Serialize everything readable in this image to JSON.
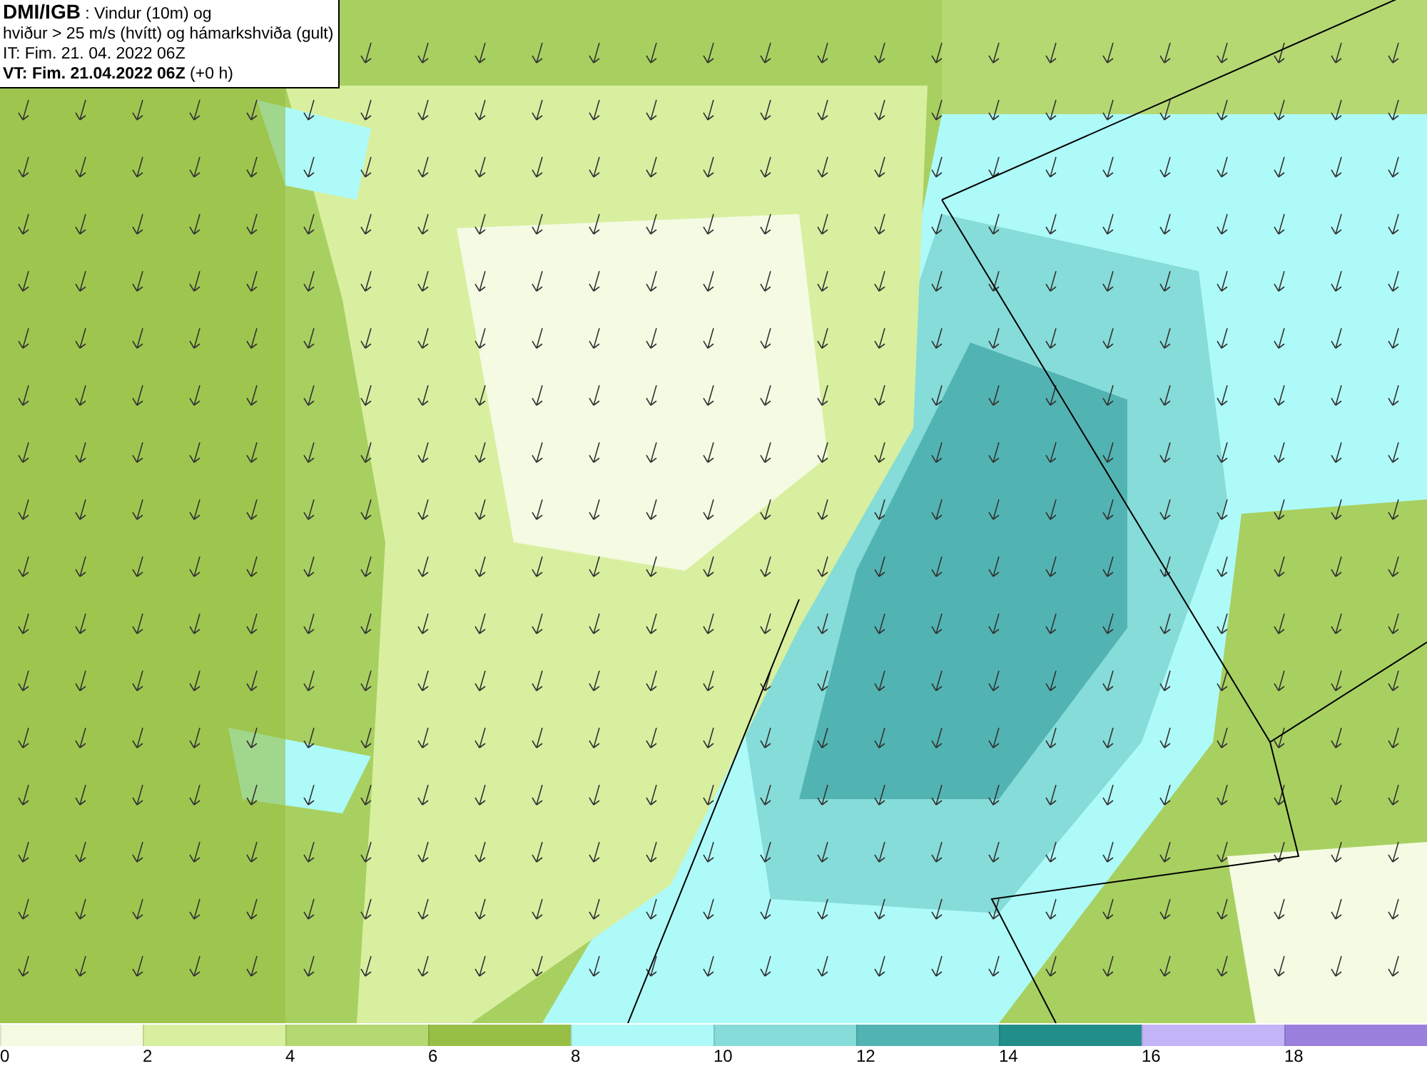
{
  "header": {
    "lines": [
      "**DMI/IGB** : Vindur (10m) og",
      "hviður > 25 m/s (hvítt) og hámarkshviða (gult)",
      "IT: Fim. 21. 04. 2022 06Z",
      "**VT: Fim. 21.04.2022 06Z** (+0 h)"
    ]
  },
  "legend": [
    {
      "color": "#f4fbe2",
      "label": "0"
    },
    {
      "color": "#d8efa0",
      "label": "2"
    },
    {
      "color": "#b5d872",
      "label": "4"
    },
    {
      "color": "#97bf45",
      "label": "6"
    },
    {
      "color": "#aefaf8",
      "label": "8"
    },
    {
      "color": "#86dcd8",
      "label": "10"
    },
    {
      "color": "#52b4b2",
      "label": "12"
    },
    {
      "color": "#228e8a",
      "label": "14"
    },
    {
      "color": "#c2b4f6",
      "label": "16"
    },
    {
      "color": "#9a80dc",
      "label": "18"
    }
  ]
}
